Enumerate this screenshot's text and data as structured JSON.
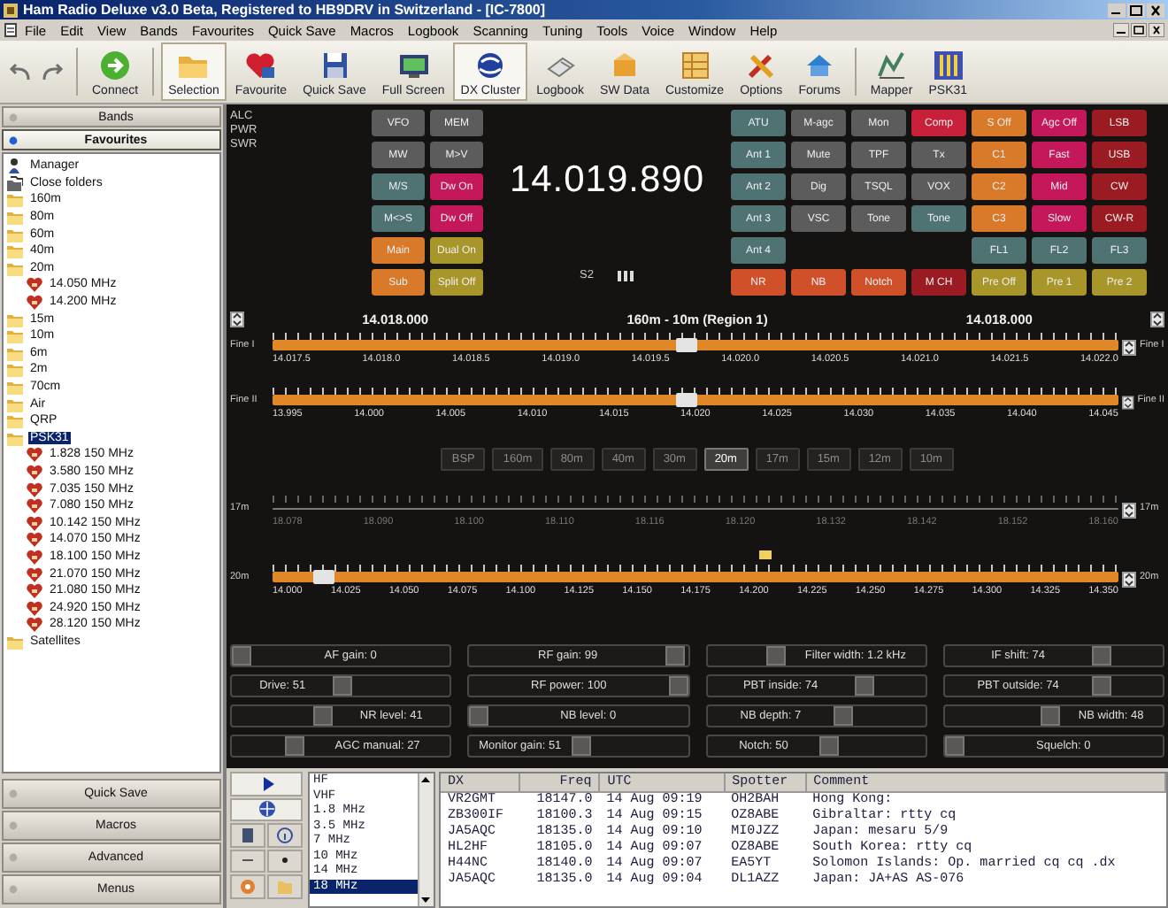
{
  "window": {
    "title": "Ham Radio Deluxe v3.0 Beta, Registered to HB9DRV in Switzerland - [IC-7800]"
  },
  "menu": [
    "File",
    "Edit",
    "View",
    "Bands",
    "Favourites",
    "Quick Save",
    "Macros",
    "Logbook",
    "Scanning",
    "Tuning",
    "Tools",
    "Voice",
    "Window",
    "Help"
  ],
  "toolbar": [
    {
      "label": "Connect",
      "pressed": false
    },
    {
      "label": "Selection",
      "pressed": true
    },
    {
      "label": "Favourite",
      "pressed": false
    },
    {
      "label": "Quick Save",
      "pressed": false
    },
    {
      "label": "Full Screen",
      "pressed": false
    },
    {
      "label": "DX Cluster",
      "pressed": true
    },
    {
      "label": "Logbook",
      "pressed": false
    },
    {
      "label": "SW Data",
      "pressed": false
    },
    {
      "label": "Customize",
      "pressed": false
    },
    {
      "label": "Options",
      "pressed": false
    },
    {
      "label": "Forums",
      "pressed": false
    },
    {
      "label": "Mapper",
      "pressed": false
    },
    {
      "label": "PSK31",
      "pressed": false
    }
  ],
  "sidebar": {
    "panels": [
      {
        "label": "Bands",
        "selected": false
      },
      {
        "label": "Favourites",
        "selected": true
      }
    ],
    "tree": [
      {
        "kind": "manager",
        "label": "Manager",
        "selected": false
      },
      {
        "kind": "close",
        "label": "Close folders",
        "selected": false
      },
      {
        "kind": "folder",
        "label": "160m",
        "selected": false
      },
      {
        "kind": "folder",
        "label": "80m",
        "selected": false
      },
      {
        "kind": "folder",
        "label": "60m",
        "selected": false
      },
      {
        "kind": "folder",
        "label": "40m",
        "selected": false
      },
      {
        "kind": "folder",
        "label": "20m",
        "selected": false,
        "children": [
          {
            "kind": "favourite",
            "label": "14.050 MHz",
            "selected": false
          },
          {
            "kind": "favourite",
            "label": "14.200 MHz",
            "selected": false
          }
        ]
      },
      {
        "kind": "folder",
        "label": "15m",
        "selected": false
      },
      {
        "kind": "folder",
        "label": "10m",
        "selected": false
      },
      {
        "kind": "folder",
        "label": "6m",
        "selected": false
      },
      {
        "kind": "folder",
        "label": "2m",
        "selected": false
      },
      {
        "kind": "folder",
        "label": "70cm",
        "selected": false
      },
      {
        "kind": "folder",
        "label": "Air",
        "selected": false
      },
      {
        "kind": "folder",
        "label": "QRP",
        "selected": false
      },
      {
        "kind": "folder",
        "label": "PSK31",
        "selected": true,
        "children": [
          {
            "kind": "favourite",
            "label": "1.828 150 MHz",
            "selected": false
          },
          {
            "kind": "favourite",
            "label": "3.580 150 MHz",
            "selected": false
          },
          {
            "kind": "favourite",
            "label": "7.035 150 MHz",
            "selected": false
          },
          {
            "kind": "favourite",
            "label": "7.080 150 MHz",
            "selected": false
          },
          {
            "kind": "favourite",
            "label": "10.142 150 MHz",
            "selected": false
          },
          {
            "kind": "favourite",
            "label": "14.070 150 MHz",
            "selected": false
          },
          {
            "kind": "favourite",
            "label": "18.100 150 MHz",
            "selected": false
          },
          {
            "kind": "favourite",
            "label": "21.070 150 MHz",
            "selected": false
          },
          {
            "kind": "favourite",
            "label": "21.080 150 MHz",
            "selected": false
          },
          {
            "kind": "favourite",
            "label": "24.920 150 MHz",
            "selected": false
          },
          {
            "kind": "favourite",
            "label": "28.120 150 MHz",
            "selected": false
          }
        ]
      },
      {
        "kind": "folder",
        "label": "Satellites",
        "selected": false
      }
    ],
    "bottom_panels": [
      "Quick Save",
      "Macros",
      "Advanced",
      "Menus"
    ]
  },
  "radio": {
    "meters": [
      "ALC",
      "PWR",
      "SWR"
    ],
    "left_buttons": [
      [
        {
          "kind": "button",
          "label": "VFO",
          "color": "#5c5c5c"
        },
        {
          "kind": "button",
          "label": "MEM",
          "color": "#5c5c5c"
        }
      ],
      [
        {
          "kind": "button",
          "label": "MW",
          "color": "#5c5c5c"
        },
        {
          "kind": "button",
          "label": "M>V",
          "color": "#5c5c5c"
        }
      ],
      [
        {
          "kind": "button",
          "label": "M/S",
          "color": "#4f7272"
        },
        {
          "kind": "button",
          "label": "Dw On",
          "color": "#c4185a"
        }
      ],
      [
        {
          "kind": "button",
          "label": "M<>S",
          "color": "#4f7272"
        },
        {
          "kind": "button",
          "label": "Dw Off",
          "color": "#c4185a"
        }
      ],
      [
        {
          "kind": "button",
          "label": "Main",
          "color": "#d87a2a"
        },
        {
          "kind": "button",
          "label": "Dual On",
          "color": "#a8962a"
        }
      ],
      [
        {
          "kind": "button",
          "label": "Sub",
          "color": "#d87a2a"
        },
        {
          "kind": "button",
          "label": "Split Off",
          "color": "#a8962a"
        }
      ]
    ],
    "frequency": "14.019.890",
    "s_meter": "S2",
    "right_buttons": [
      [
        {
          "kind": "button",
          "label": "ATU",
          "color": "#4f7272"
        },
        {
          "kind": "button",
          "label": "M-agc",
          "color": "#5c5c5c"
        },
        {
          "kind": "button",
          "label": "Mon",
          "color": "#5c5c5c"
        },
        {
          "kind": "button",
          "label": "Comp",
          "color": "#c8203a"
        },
        {
          "kind": "button",
          "label": "S Off",
          "color": "#d87a2a"
        },
        {
          "kind": "button",
          "label": "Agc Off",
          "color": "#c4185a"
        },
        {
          "kind": "button",
          "label": "LSB",
          "color": "#9a1c22"
        }
      ],
      [
        {
          "kind": "button",
          "label": "Ant 1",
          "color": "#4f7272"
        },
        {
          "kind": "button",
          "label": "Mute",
          "color": "#5c5c5c"
        },
        {
          "kind": "button",
          "label": "TPF",
          "color": "#5c5c5c"
        },
        {
          "kind": "button",
          "label": "Tx",
          "color": "#5c5c5c"
        },
        {
          "kind": "button",
          "label": "C1",
          "color": "#d87a2a"
        },
        {
          "kind": "button",
          "label": "Fast",
          "color": "#c4185a"
        },
        {
          "kind": "button",
          "label": "USB",
          "color": "#9a1c22"
        }
      ],
      [
        {
          "kind": "button",
          "label": "Ant 2",
          "color": "#4f7272"
        },
        {
          "kind": "button",
          "label": "Dig",
          "color": "#5c5c5c"
        },
        {
          "kind": "button",
          "label": "TSQL",
          "color": "#5c5c5c"
        },
        {
          "kind": "button",
          "label": "VOX",
          "color": "#5c5c5c"
        },
        {
          "kind": "button",
          "label": "C2",
          "color": "#d87a2a"
        },
        {
          "kind": "button",
          "label": "Mid",
          "color": "#c4185a"
        },
        {
          "kind": "button",
          "label": "CW",
          "color": "#9a1c22"
        }
      ],
      [
        {
          "kind": "button",
          "label": "Ant 3",
          "color": "#4f7272"
        },
        {
          "kind": "button",
          "label": "VSC",
          "color": "#5c5c5c"
        },
        {
          "kind": "button",
          "label": "Tone",
          "color": "#5c5c5c"
        },
        {
          "kind": "button",
          "label": "Tone",
          "color": "#4f7272"
        },
        {
          "kind": "button",
          "label": "C3",
          "color": "#d87a2a"
        },
        {
          "kind": "button",
          "label": "Slow",
          "color": "#c4185a"
        },
        {
          "kind": "button",
          "label": "CW-R",
          "color": "#9a1c22"
        }
      ],
      [
        {
          "kind": "button",
          "label": "Ant 4",
          "color": "#4f7272"
        },
        {
          "kind": "blank"
        },
        {
          "kind": "blank"
        },
        {
          "kind": "blank"
        },
        {
          "kind": "button",
          "label": "FL1",
          "color": "#4f7272"
        },
        {
          "kind": "button",
          "label": "FL2",
          "color": "#4f7272"
        },
        {
          "kind": "button",
          "label": "FL3",
          "color": "#4f7272"
        }
      ],
      [
        {
          "kind": "button",
          "label": "NR",
          "color": "#d0502a"
        },
        {
          "kind": "button",
          "label": "NB",
          "color": "#d0502a"
        },
        {
          "kind": "button",
          "label": "Notch",
          "color": "#d0502a"
        },
        {
          "kind": "button",
          "label": "M CH",
          "color": "#9a1c22"
        },
        {
          "kind": "button",
          "label": "Pre Off",
          "color": "#a8962a"
        },
        {
          "kind": "button",
          "label": "Pre 1",
          "color": "#a8962a"
        },
        {
          "kind": "button",
          "label": "Pre 2",
          "color": "#a8962a"
        }
      ]
    ]
  },
  "tuner": {
    "left_frequency": "14.018.000",
    "band_plan": "160m - 10m (Region 1)",
    "right_frequency": "14.018.000",
    "fine_scales": [
      {
        "kind": "active",
        "label": "Fine I",
        "right_label": "Fine I",
        "level": 0.49,
        "ticks": [
          "14.017.5",
          "14.018.0",
          "14.018.5",
          "14.019.0",
          "14.019.5",
          "14.020.0",
          "14.020.5",
          "14.021.0",
          "14.021.5",
          "14.022.0"
        ]
      },
      {
        "kind": "active",
        "label": "Fine II",
        "right_label": "Fine II",
        "level": 0.49,
        "ticks": [
          "13.995",
          "14.000",
          "14.005",
          "14.010",
          "14.015",
          "14.020",
          "14.025",
          "14.030",
          "14.035",
          "14.040",
          "14.045"
        ]
      }
    ],
    "bands": [
      {
        "label": "BSP",
        "selected": false
      },
      {
        "label": "160m",
        "selected": false
      },
      {
        "label": "80m",
        "selected": false
      },
      {
        "label": "40m",
        "selected": false
      },
      {
        "label": "30m",
        "selected": false
      },
      {
        "label": "20m",
        "selected": true
      },
      {
        "label": "17m",
        "selected": false
      },
      {
        "label": "15m",
        "selected": false
      },
      {
        "label": "12m",
        "selected": false
      },
      {
        "label": "10m",
        "selected": false
      }
    ],
    "band_scales": [
      {
        "kind": "idle",
        "label": "17m",
        "right_label": "17m",
        "ticks": [
          "18.078",
          "18.090",
          "18.100",
          "18.110",
          "18.116",
          "18.120",
          "18.132",
          "18.142",
          "18.152",
          "18.160"
        ]
      },
      {
        "kind": "active",
        "label": "20m",
        "right_label": "20m",
        "level": 0.05,
        "ticks": [
          "14.000",
          "14.025",
          "14.050",
          "14.075",
          "14.100",
          "14.125",
          "14.150",
          "14.175",
          "14.200",
          "14.225",
          "14.250",
          "14.275",
          "14.300",
          "14.325",
          "14.350"
        ]
      }
    ]
  },
  "controls": [
    {
      "label": "AF gain: 0",
      "level": 0
    },
    {
      "label": "RF gain: 99",
      "level": 0.99
    },
    {
      "label": "Filter width: 1.2 kHz",
      "level": 0.3
    },
    {
      "label": "IF shift: 74",
      "level": 0.74
    },
    {
      "label": "Drive: 51",
      "level": 0.51
    },
    {
      "label": "RF power: 100",
      "level": 1
    },
    {
      "label": "PBT inside: 74",
      "level": 0.74
    },
    {
      "label": "PBT outside: 74",
      "level": 0.74
    },
    {
      "label": "NR level: 41",
      "level": 0.41
    },
    {
      "label": "NB level: 0",
      "level": 0
    },
    {
      "label": "NB depth: 7",
      "level": 0.64
    },
    {
      "label": "NB width: 48",
      "level": 0.48
    },
    {
      "label": "AGC manual: 27",
      "level": 0.27
    },
    {
      "label": "Monitor gain: 51",
      "level": 0.51
    },
    {
      "label": "Notch: 50",
      "level": 0.57
    },
    {
      "label": "Squelch: 0",
      "level": 0
    }
  ],
  "band_list": [
    {
      "label": "HF",
      "selected": false
    },
    {
      "label": "VHF",
      "selected": false
    },
    {
      "label": "1.8 MHz",
      "selected": false
    },
    {
      "label": "3.5 MHz",
      "selected": false
    },
    {
      "label": "7 MHz",
      "selected": false
    },
    {
      "label": "10 MHz",
      "selected": false
    },
    {
      "label": "14 MHz",
      "selected": false
    },
    {
      "label": "18 MHz",
      "selected": true
    }
  ],
  "dx_cluster": {
    "columns": [
      "DX",
      "Freq",
      "UTC",
      "Spotter",
      "Comment"
    ],
    "rows": [
      [
        "VR2GMT",
        "18147.0",
        "14 Aug 09:19",
        "OH2BAH",
        "Hong Kong:"
      ],
      [
        "ZB300IF",
        "18100.3",
        "14 Aug 09:15",
        "OZ8ABE",
        "Gibraltar: rtty cq"
      ],
      [
        "JA5AQC",
        "18135.0",
        "14 Aug 09:10",
        "MI0JZZ",
        "Japan: mesaru 5/9"
      ],
      [
        "HL2HF",
        "18105.0",
        "14 Aug 09:07",
        "OZ8ABE",
        "South Korea: rtty cq"
      ],
      [
        "H44NC",
        "18140.0",
        "14 Aug 09:07",
        "EA5YT",
        "Solomon Islands: Op. married cq cq .dx"
      ],
      [
        "JA5AQC",
        "18135.0",
        "14 Aug 09:04",
        "DL1AZZ",
        "Japan: JA+AS AS-076"
      ]
    ]
  }
}
